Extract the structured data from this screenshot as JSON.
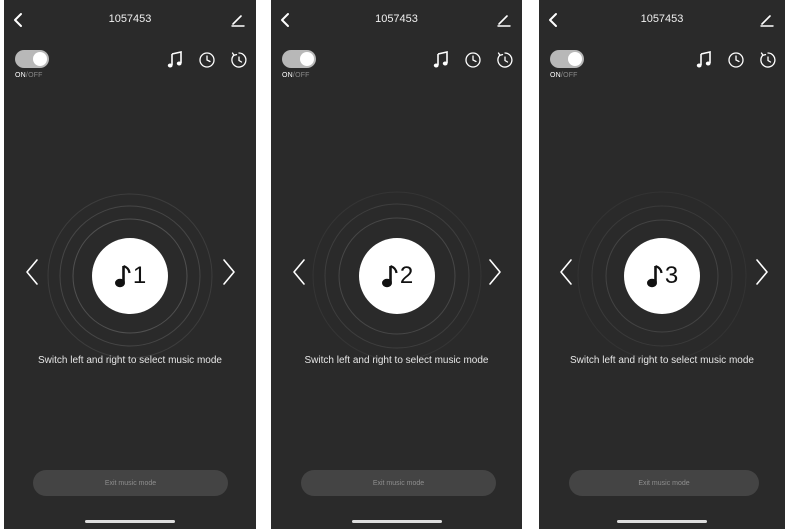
{
  "icons": [
    "chevron-left-icon",
    "pencil-icon",
    "music-note-icon",
    "clock-icon",
    "timer-icon",
    "chevron-right-icon"
  ],
  "colors": {
    "screen_background": "#2a2a2a",
    "toggle_track": "#b8b8b8",
    "disc": "#ffffff",
    "exit_button": "#444444"
  },
  "screens": [
    {
      "title": "1057453",
      "power": {
        "on_label": "ON",
        "separator": "/",
        "off_label": "OFF",
        "is_on": true
      },
      "mode_number": "1",
      "hint": "Switch left and right to select music mode",
      "exit_label": "Exit music mode"
    },
    {
      "title": "1057453",
      "power": {
        "on_label": "ON",
        "separator": "/",
        "off_label": "OFF",
        "is_on": true
      },
      "mode_number": "2",
      "hint": "Switch left and right to select music mode",
      "exit_label": "Exit music mode"
    },
    {
      "title": "1057453",
      "power": {
        "on_label": "ON",
        "separator": "/",
        "off_label": "OFF",
        "is_on": true
      },
      "mode_number": "3",
      "hint": "Switch left and right to select music mode",
      "exit_label": "Exit music mode"
    }
  ]
}
